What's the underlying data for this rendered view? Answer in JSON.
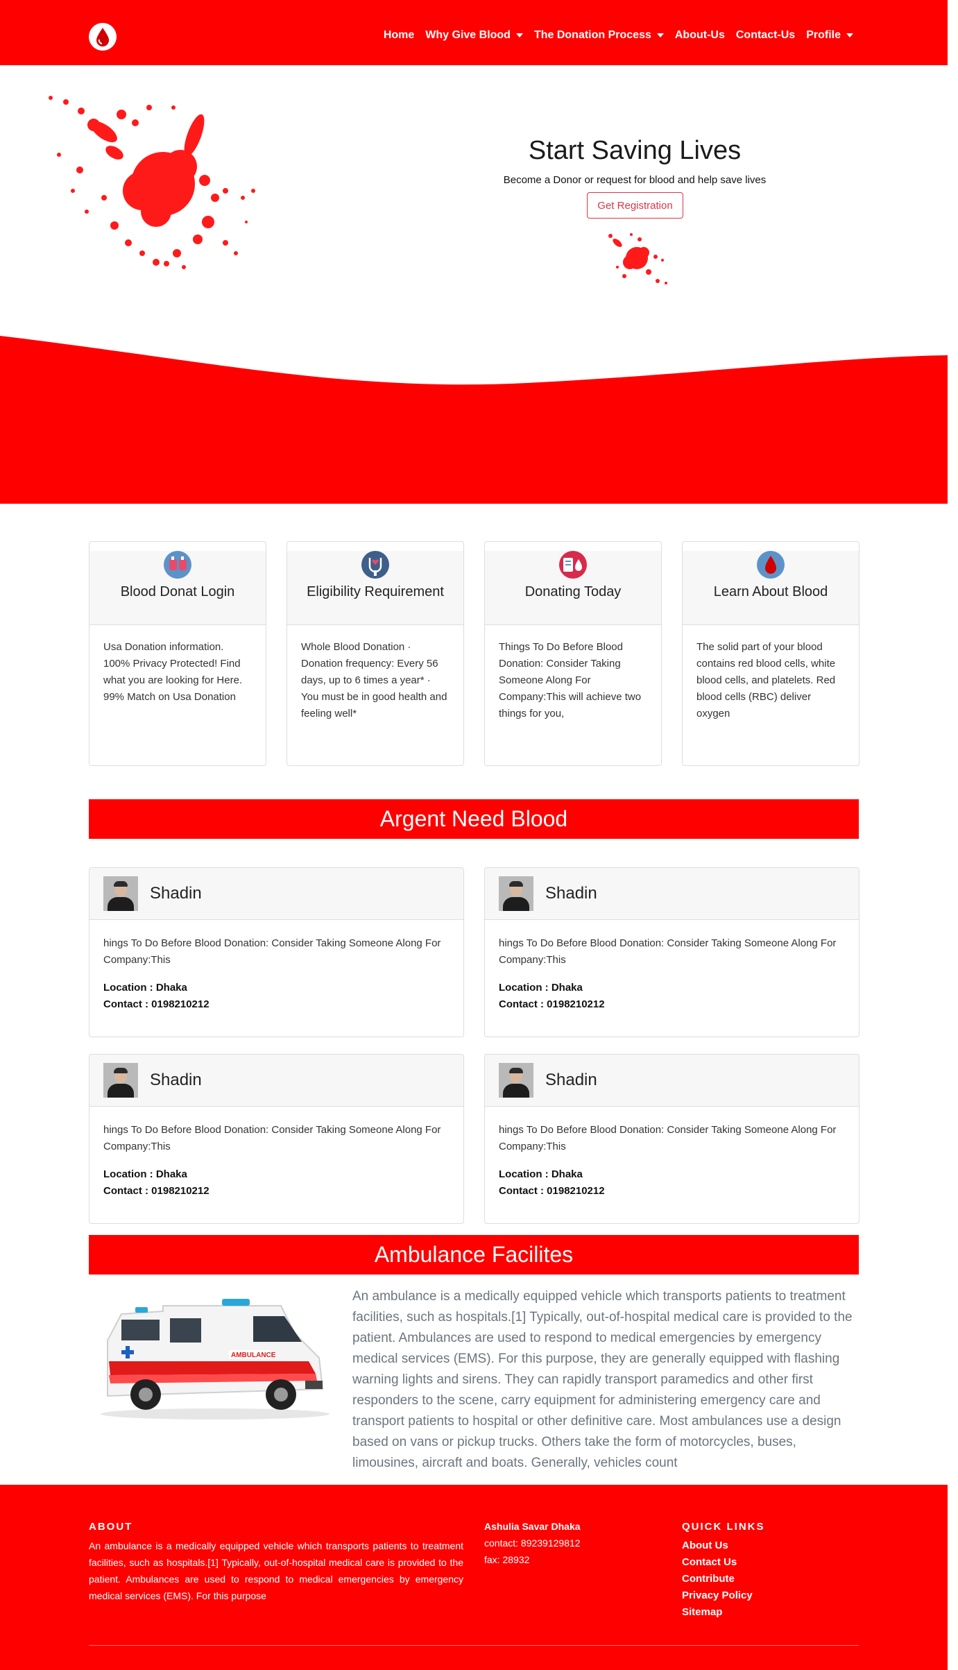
{
  "nav": {
    "items": [
      {
        "label": "Home",
        "dropdown": false
      },
      {
        "label": "Why Give Blood",
        "dropdown": true
      },
      {
        "label": "The Donation Process",
        "dropdown": true
      },
      {
        "label": "About-Us",
        "dropdown": false
      },
      {
        "label": "Contact-Us",
        "dropdown": false
      },
      {
        "label": "Profile",
        "dropdown": true
      }
    ]
  },
  "hero": {
    "title": "Start Saving Lives",
    "subtitle": "Become a Donor or request for blood and help save lives",
    "button": "Get Registration"
  },
  "features": [
    {
      "title": "Blood Donat Login",
      "icon": "blood-bag-icon",
      "text": "Usa Donation information. 100% Privacy Protected! Find what you are looking for Here. 99% Match on Usa Donation"
    },
    {
      "title": "Eligibility Requirement",
      "icon": "stethoscope-icon",
      "text": "Whole Blood Donation · Donation frequency: Every 56 days, up to 6 times a year* · You must be in good health and feeling well*"
    },
    {
      "title": "Donating Today",
      "icon": "donation-icon",
      "text": "Things To Do Before Blood Donation: Consider Taking Someone Along For Company:This will achieve two things for you,"
    },
    {
      "title": "Learn About Blood",
      "icon": "blood-drop-icon",
      "text": "The solid part of your blood contains red blood cells, white blood cells, and platelets. Red blood cells (RBC) deliver oxygen"
    }
  ],
  "urgent": {
    "title": "Argent Need Blood",
    "cards": [
      {
        "name": "Shadin",
        "text": "hings To Do Before Blood Donation: Consider Taking Someone Along For Company:This",
        "location": "Location : Dhaka",
        "contact": "Contact : 0198210212"
      },
      {
        "name": "Shadin",
        "text": "hings To Do Before Blood Donation: Consider Taking Someone Along For Company:This",
        "location": "Location : Dhaka",
        "contact": "Contact : 0198210212"
      },
      {
        "name": "Shadin",
        "text": "hings To Do Before Blood Donation: Consider Taking Someone Along For Company:This",
        "location": "Location : Dhaka",
        "contact": "Contact : 0198210212"
      },
      {
        "name": "Shadin",
        "text": "hings To Do Before Blood Donation: Consider Taking Someone Along For Company:This",
        "location": "Location : Dhaka",
        "contact": "Contact : 0198210212"
      }
    ]
  },
  "ambulance": {
    "title": "Ambulance Facilites",
    "text": "An ambulance is a medically equipped vehicle which transports patients to treatment facilities, such as hospitals.[1] Typically, out-of-hospital medical care is provided to the patient. Ambulances are used to respond to medical emergencies by emergency medical services (EMS). For this purpose, they are generally equipped with flashing warning lights and sirens. They can rapidly transport paramedics and other first responders to the scene, carry equipment for administering emergency care and transport patients to hospital or other definitive care. Most ambulances use a design based on vans or pickup trucks. Others take the form of motorcycles, buses, limousines, aircraft and boats. Generally, vehicles count",
    "vehicle_label": "AMBULANCE"
  },
  "footer": {
    "about_title": "ABOUT",
    "about_text": "An ambulance is a medically equipped vehicle which transports patients to treatment facilities, such as hospitals.[1] Typically, out-of-hospital medical care is provided to the patient. Ambulances are used to respond to medical emergencies by emergency medical services (EMS). For this purpose",
    "address": "Ashulia Savar Dhaka",
    "contact": "contact: 89239129812",
    "fax": "fax: 28932",
    "links_title": "QUICK LINKS",
    "links": [
      "About Us",
      "Contact Us",
      "Contribute",
      "Privacy Policy",
      "Sitemap"
    ]
  },
  "colors": {
    "brand": "#ff0000",
    "button_outline": "#dc3545"
  }
}
